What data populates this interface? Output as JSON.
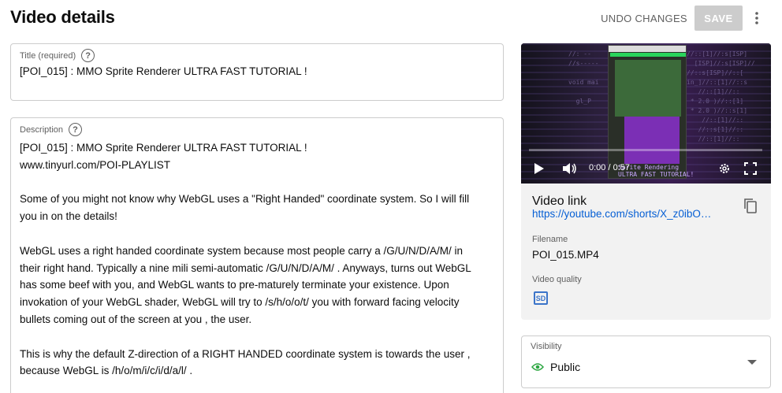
{
  "header": {
    "title": "Video details",
    "undo_label": "UNDO CHANGES",
    "save_label": "SAVE"
  },
  "title_field": {
    "label": "Title (required)",
    "help": "?",
    "value": "[POI_015] : MMO Sprite Renderer ULTRA FAST TUTORIAL !"
  },
  "description_field": {
    "label": "Description",
    "help": "?",
    "lines": [
      "[POI_015] : MMO Sprite Renderer ULTRA FAST TUTORIAL !",
      "www.tinyurl.com/POI-PLAYLIST",
      "",
      "Some of you might not know why WebGL uses a \"Right Handed\" coordinate system. So I will fill",
      "you in on the details!",
      "",
      "WebGL uses a right handed coordinate system because most people carry a /G/U/N/D/A/M/ in",
      "their right hand. Typically a nine mili semi-automatic /G/U/N/D/A/M/ . Anyways, turns out WebGL",
      "has some beef with you, and WebGL wants to pre-maturely terminate your existence. Upon",
      "invokation of your WebGL shader, WebGL will try to /s/h/o/o/t/ you with forward facing velocity",
      "bullets coming out of the screen at you , the user.",
      "",
      "This is why the default Z-direction of a RIGHT HANDED coordinate system is towards the user ,",
      "because WebGL is /h/o/m/i/c/i/d/a/l/ ."
    ]
  },
  "player": {
    "time": "0:00 / 0:57",
    "progress": 0.0,
    "overlay_text": "Sprite Rendering\nULTRA FAST TUTORIAL!"
  },
  "video_info": {
    "link_label": "Video link",
    "link_value": "https://youtube.com/shorts/X_z0ibO…",
    "filename_label": "Filename",
    "filename_value": "POI_015.MP4",
    "quality_label": "Video quality",
    "quality_badge": "SD"
  },
  "visibility": {
    "label": "Visibility",
    "value": "Public"
  },
  "colors": {
    "accent_link": "#065fd4",
    "visibility_icon": "#2ba640",
    "sd_badge": "#3b74c9"
  }
}
